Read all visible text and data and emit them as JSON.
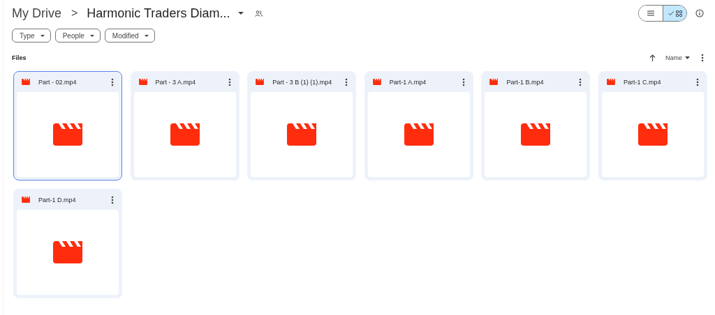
{
  "breadcrumb": {
    "root": "My Drive",
    "separator": ">",
    "current": "Harmonic Traders Diam..."
  },
  "view_toggle": [
    {
      "kind": "list",
      "selected": false
    },
    {
      "kind": "grid",
      "selected": true
    }
  ],
  "filters": [
    {
      "label": "Type"
    },
    {
      "label": "People"
    },
    {
      "label": "Modified"
    }
  ],
  "section_title": "Files",
  "sort": {
    "label": "Name"
  },
  "files": [
    {
      "name": "Part - 02.mp4",
      "selected": true
    },
    {
      "name": "Part - 3 A.mp4",
      "selected": false
    },
    {
      "name": "Part - 3 B (1) (1).mp4",
      "selected": false
    },
    {
      "name": "Part-1 A.mp4",
      "selected": false
    },
    {
      "name": "Part-1 B.mp4",
      "selected": false
    },
    {
      "name": "Part-1 C.mp4",
      "selected": false
    },
    {
      "name": "Part-1 D.mp4",
      "selected": false
    }
  ]
}
